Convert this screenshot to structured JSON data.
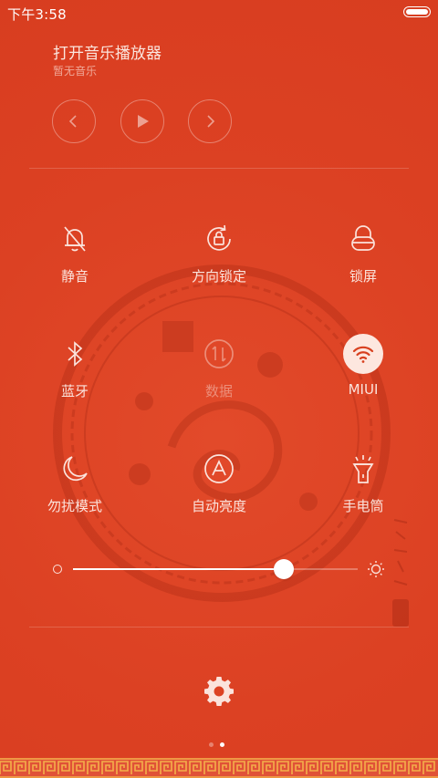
{
  "status_bar": {
    "time": "下午3:58",
    "battery_icon": "battery-icon"
  },
  "music": {
    "title": "打开音乐播放器",
    "subtitle": "暂无音乐",
    "controls": [
      {
        "name": "previous-button",
        "icon": "chevron-left-icon"
      },
      {
        "name": "play-button",
        "icon": "play-icon"
      },
      {
        "name": "next-button",
        "icon": "chevron-right-icon"
      }
    ]
  },
  "toggles": [
    {
      "id": "mute",
      "label": "静音",
      "icon": "bell-off-icon",
      "state": "off"
    },
    {
      "id": "rotation-lock",
      "label": "方向锁定",
      "icon": "rotation-lock-icon",
      "state": "off"
    },
    {
      "id": "lock-screen",
      "label": "锁屏",
      "icon": "lock-icon",
      "state": "off"
    },
    {
      "id": "bluetooth",
      "label": "蓝牙",
      "icon": "bluetooth-icon",
      "state": "off"
    },
    {
      "id": "data",
      "label": "数据",
      "icon": "data-arrows-icon",
      "state": "disabled"
    },
    {
      "id": "wifi",
      "label": "MIUI",
      "icon": "wifi-icon",
      "state": "on"
    },
    {
      "id": "do-not-disturb",
      "label": "勿扰模式",
      "icon": "moon-icon",
      "state": "off"
    },
    {
      "id": "auto-brightness",
      "label": "自动亮度",
      "icon": "auto-brightness-icon",
      "state": "off"
    },
    {
      "id": "flashlight",
      "label": "手电筒",
      "icon": "flashlight-icon",
      "state": "off"
    }
  ],
  "brightness": {
    "level": 0.74,
    "low_icon": "brightness-low-icon",
    "high_icon": "sun-icon"
  },
  "settings": {
    "icon": "gear-icon"
  },
  "pages": {
    "count": 2,
    "current": 2
  },
  "colors": {
    "background": "#df4526",
    "text": "#fbe3dc",
    "active_toggle": "#fde7df",
    "white": "#ffffff"
  }
}
